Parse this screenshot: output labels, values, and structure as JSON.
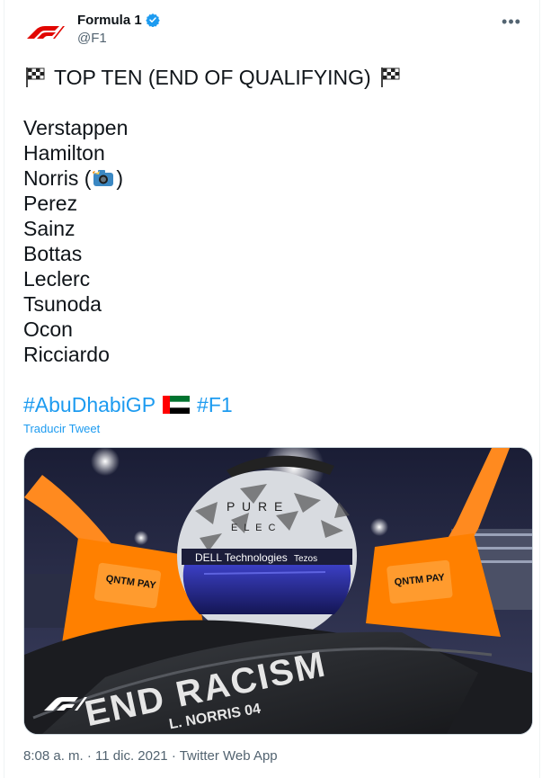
{
  "header": {
    "display_name": "Formula 1",
    "handle": "@F1",
    "verified_icon": "verified-badge-icon",
    "more_label": "•••"
  },
  "tweet": {
    "heading": "TOP TEN (END OF QUALIFYING)",
    "drivers": [
      "Verstappen",
      "Hamilton",
      "Norris (",
      "Perez",
      "Sainz",
      "Bottas",
      "Leclerc",
      "Tsunoda",
      "Ocon",
      "Ricciardo"
    ],
    "norris_suffix": ")",
    "hashtag_1": "#AbuDhabiGP",
    "hashtag_2": "#F1",
    "translate_label": "Traducir Tweet"
  },
  "media": {
    "helmet_text_top": "P U R E",
    "helmet_text_mid": "E L E C",
    "sponsor_1": "DELL Technologies",
    "sponsor_2": "Tezos",
    "mirror_left": "QNTM PAY",
    "mirror_right": "QNTM PAY",
    "message": "END RACISM",
    "driver_tag": "L. NORRIS 04",
    "f1_logo_text": "F1"
  },
  "meta": {
    "timestamp": "8:08 a. m. · 11 dic. 2021 · Twitter Web App"
  },
  "colors": {
    "accent": "#1d9bf0",
    "f1_red": "#e10600",
    "papaya": "#ff8000"
  }
}
